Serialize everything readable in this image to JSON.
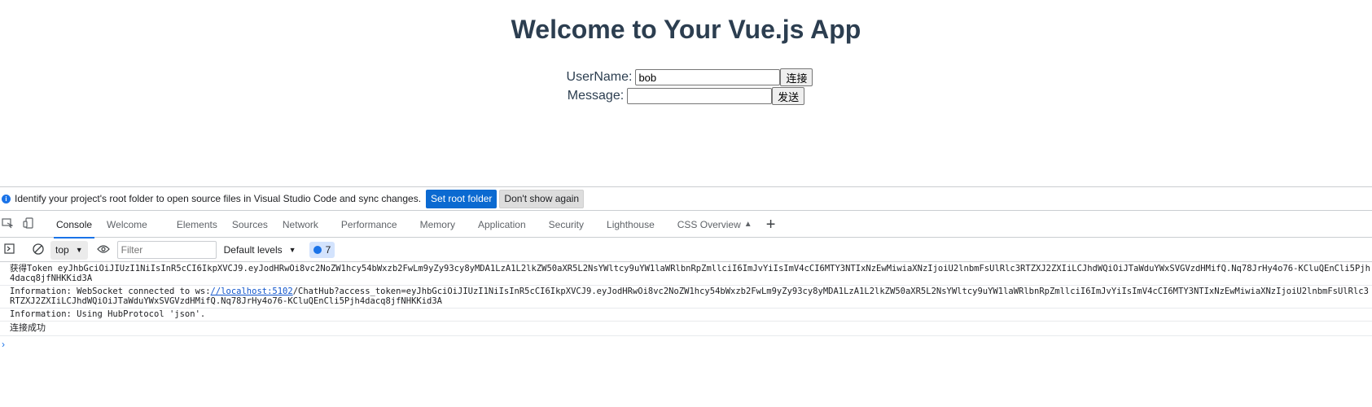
{
  "app": {
    "title": "Welcome to Your Vue.js App",
    "username_label": "UserName:",
    "username_value": "bob",
    "connect_button": "连接",
    "message_label": "Message:",
    "message_value": "",
    "send_button": "发送"
  },
  "devtools": {
    "infobar": {
      "text": "Identify your project's root folder to open source files in Visual Studio Code and sync changes.",
      "primary_button": "Set root folder",
      "secondary_button": "Don't show again"
    },
    "tabs": [
      "Console",
      "Welcome",
      "Elements",
      "Sources",
      "Network",
      "Performance",
      "Memory",
      "Application",
      "Security",
      "Lighthouse",
      "CSS Overview"
    ],
    "active_tab": "Console",
    "toolbar": {
      "context": "top",
      "filter_placeholder": "Filter",
      "levels": "Default levels",
      "issues_count": "7"
    },
    "messages": {
      "m1": "获得Token eyJhbGciOiJIUzI1NiIsInR5cCI6IkpXVCJ9.eyJodHRwOi8vc2NoZW1hcy54bWxzb2FwLm9yZy93cy8yMDA1LzA1L2lkZW50aXR5L2NsYWltcy9uYW1laWRlbnRpZmllciI6ImJvYiIsImV4cCI6MTY3NTIxNzEwMiwiaXNzIjoiU2lnbmFsUlRlc3RTZXJ2ZXIiLCJhdWQiOiJTaWduYWxSVGVzdHMifQ.Nq78JrHy4o76-KCluQEnCli5Pjh4dacq8jfNHKKid3A",
      "m2_prefix": "Information: WebSocket connected to ws:",
      "m2_link": "//localhost:5102",
      "m2_suffix": "/ChatHub?access_token=eyJhbGciOiJIUzI1NiIsInR5cCI6IkpXVCJ9.eyJodHRwOi8vc2NoZW1hcy54bWxzb2FwLm9yZy93cy8yMDA1LzA1L2lkZW50aXR5L2NsYWltcy9uYW1laWRlbnRpZmllciI6ImJvYiIsImV4cCI6MTY3NTIxNzEwMiwiaXNzIjoiU2lnbmFsUlRlc3RTZXJ2ZXIiLCJhdWQiOiJTaWduYWxSVGVzdHMifQ.Nq78JrHy4o76-KCluQEnCli5Pjh4dacq8jfNHKKid3A",
      "m3": "Information: Using HubProtocol 'json'.",
      "m4": "连接成功"
    }
  }
}
